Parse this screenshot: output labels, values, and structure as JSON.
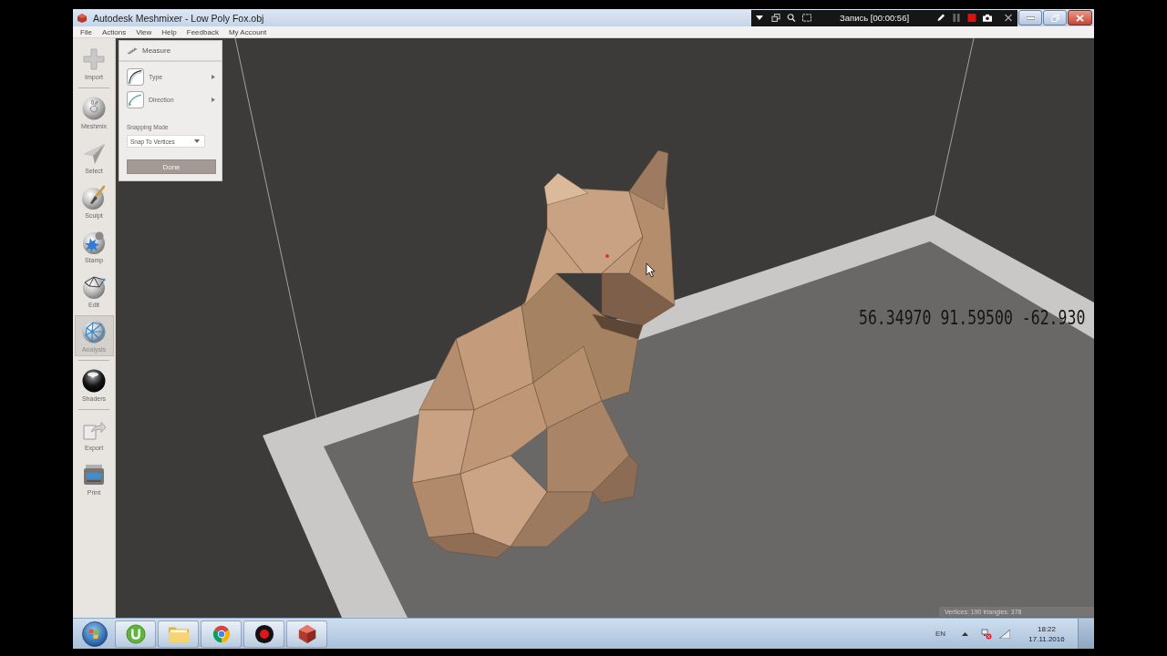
{
  "window": {
    "title": "Autodesk Meshmixer - Low Poly Fox.obj"
  },
  "recorder": {
    "status": "Запись [00:00:56]"
  },
  "menu": [
    "File",
    "Actions",
    "View",
    "Help",
    "Feedback",
    "My Account"
  ],
  "toolbar": [
    {
      "label": "Import",
      "selected": false
    },
    {
      "label": "Meshmix",
      "selected": false
    },
    {
      "label": "Select",
      "selected": false
    },
    {
      "label": "Sculpt",
      "selected": false
    },
    {
      "label": "Stamp",
      "selected": false
    },
    {
      "label": "Edit",
      "selected": false
    },
    {
      "label": "Analysis",
      "selected": true
    },
    {
      "label": "Shaders",
      "selected": false
    },
    {
      "label": "Export",
      "selected": false
    },
    {
      "label": "Print",
      "selected": false
    }
  ],
  "measure_panel": {
    "title": "Measure",
    "options": [
      "Type",
      "Direction"
    ],
    "snapping_label": "Snapping Mode",
    "snapping_value": "Snap To Vertices",
    "done": "Done"
  },
  "viewport": {
    "coordinates": "56.34970 91.59500 -62.930",
    "stats": "Vertices: 190 triangles: 378"
  },
  "taskbar": {
    "language": "EN",
    "time": "18:22",
    "date": "17.11.2016"
  }
}
